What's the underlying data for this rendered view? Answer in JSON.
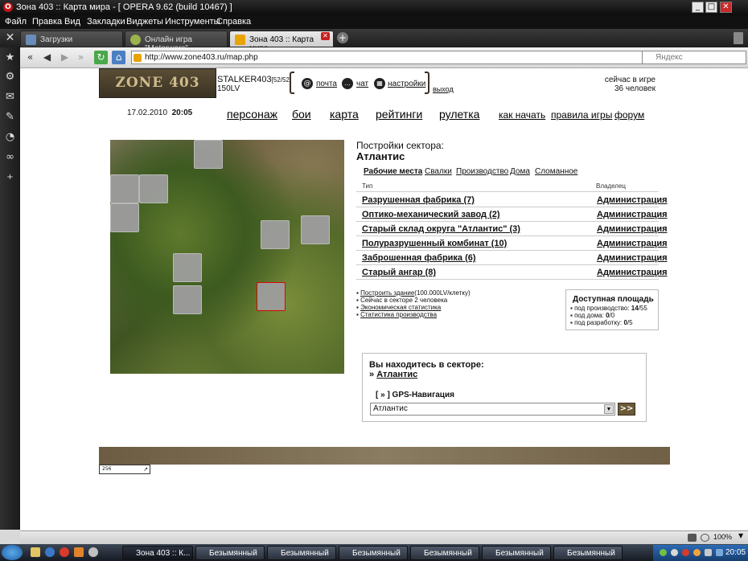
{
  "window": {
    "title": "Зона 403 :: Карта мира - [ OPERA 9.62 (build 10467) ]"
  },
  "menu": [
    "Файл",
    "Правка",
    "Вид",
    "Закладки",
    "Виджеты",
    "Инструменты",
    "Справка"
  ],
  "tabs": [
    {
      "label": "Загрузки"
    },
    {
      "label": "Онлайн игра \"Motorwars\""
    },
    {
      "label": "Зона 403 :: Карта мира"
    }
  ],
  "address": {
    "url": "http://www.zone403.ru/map.php",
    "search_placeholder": "Яндекс"
  },
  "header": {
    "logo_text": "ZONE 403",
    "player_name": "STALKER403",
    "player_level": "[52/52]",
    "player_money": "150LV",
    "link_mail": "почта",
    "link_chat": "чат",
    "link_settings": "настройки",
    "link_exit": "выход",
    "online_label": "сейчас в игре",
    "online_count": "36 человек",
    "date": "17.02.2010",
    "time": "20:05"
  },
  "main_nav": [
    "персонаж",
    "бои",
    "карта",
    "рейтинги",
    "рулетка"
  ],
  "secondary_nav": [
    "как начать",
    "правила игры",
    "форум"
  ],
  "sector": {
    "heading": "Постройки сектора:",
    "name": "Атлантис",
    "subtabs": [
      "Рабочие места",
      "Свалки",
      "Производство",
      "Дома",
      "Сломанное"
    ],
    "col_type": "Тип",
    "col_owner": "Владелец",
    "buildings": [
      {
        "name": "Разрушенная фабрика (7)",
        "owner": "Администрация"
      },
      {
        "name": "Оптико-механический завод (2)",
        "owner": "Администрация"
      },
      {
        "name": "Старый склад округа \"Атлантис\" (3)",
        "owner": "Администрация"
      },
      {
        "name": "Полуразрушенный комбинат (10)",
        "owner": "Администрация"
      },
      {
        "name": "Заброшенная фабрика (6)",
        "owner": "Администрация"
      },
      {
        "name": "Старый ангар (8)",
        "owner": "Администрация"
      }
    ],
    "links": [
      {
        "text": "Построить здание",
        "extra": "(100.000LV/клетку)"
      },
      {
        "text": "Сейчас в секторе 2 человека",
        "extra": ""
      },
      {
        "text": "Экономическая статистика",
        "extra": ""
      },
      {
        "text": "Статистика производства",
        "extra": ""
      }
    ],
    "area": {
      "title": "Доступная площадь",
      "prod_label": "под производство:",
      "prod_value": "14",
      "prod_total": "/55",
      "homes_label": "под дома:",
      "homes_value": "0",
      "homes_total": "/0",
      "dev_label": "под разработку:",
      "dev_value": "0",
      "dev_total": "/5"
    }
  },
  "location": {
    "title": "Вы находитесь в секторе:",
    "sector": "Атлантис",
    "gps_label": "[ » ] GPS-Навигация",
    "select_value": "Атлантис",
    "go_button": ">>"
  },
  "footer": {
    "counter": "256"
  },
  "status": {
    "zoom": "100%"
  },
  "taskbar": {
    "buttons": [
      "Зона 403 :: К...",
      "Безымянный -...",
      "Безымянный -...",
      "Безымянный -...",
      "Безымянный -...",
      "Безымянный -...",
      "Безымянный -..."
    ],
    "clock": "20:05"
  }
}
